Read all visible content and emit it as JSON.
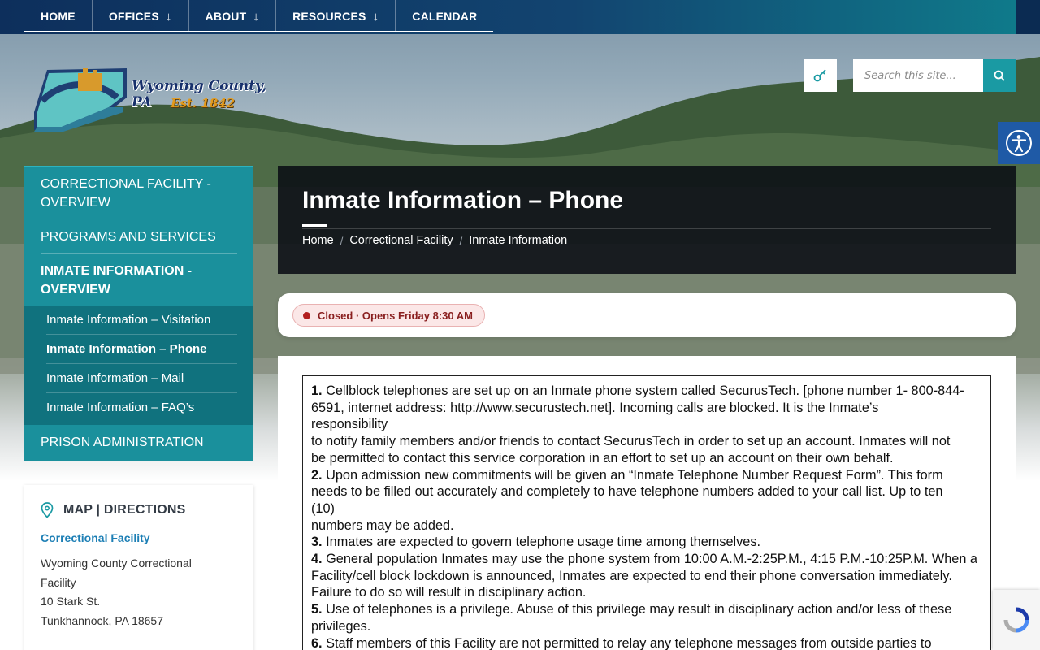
{
  "nav": {
    "items": [
      {
        "label": "HOME",
        "has_dropdown": false
      },
      {
        "label": "OFFICES",
        "has_dropdown": true
      },
      {
        "label": "ABOUT",
        "has_dropdown": true
      },
      {
        "label": "RESOURCES",
        "has_dropdown": true
      },
      {
        "label": "CALENDAR",
        "has_dropdown": false
      }
    ],
    "dropdown_glyph": "↓"
  },
  "logo": {
    "name": "Wyoming County, PA",
    "est": "Est. 1842"
  },
  "search": {
    "placeholder": "Search this site...",
    "button_icon": "search-icon",
    "login_icon": "key-icon"
  },
  "accessibility": {
    "icon": "accessibility-icon"
  },
  "sidebar": {
    "items": [
      {
        "label": "CORRECTIONAL FACILITY - OVERVIEW"
      },
      {
        "label": "PROGRAMS AND SERVICES"
      },
      {
        "label": "INMATE INFORMATION - OVERVIEW"
      }
    ],
    "subitems": [
      {
        "label": "Inmate Information – Visitation"
      },
      {
        "label": "Inmate Information – Phone"
      },
      {
        "label": "Inmate Information – Mail"
      },
      {
        "label": "Inmate Information – FAQ’s"
      }
    ],
    "last_item": {
      "label": "PRISON ADMINISTRATION"
    }
  },
  "map": {
    "title": "MAP | DIRECTIONS",
    "link": "Correctional Facility",
    "address": [
      "Wyoming County Correctional",
      "Facility",
      "10 Stark St.",
      "Tunkhannock, PA 18657"
    ]
  },
  "page": {
    "title": "Inmate Information – Phone",
    "breadcrumbs": [
      "Home",
      "Correctional Facility",
      "Inmate Information"
    ],
    "separator": "/"
  },
  "status": {
    "text": "Closed · Opens Friday 8:30 AM",
    "color": "#b21f1f"
  },
  "content": {
    "lines": [
      {
        "num": "1.",
        "text": " Cellblock telephones are set up on an Inmate phone system called SecurusTech. [phone number 1- 800-844-"
      },
      {
        "num": "",
        "text": "6591, internet address: http://www.securustech.net]. Incoming calls are blocked. It is the Inmate’s"
      },
      {
        "num": "",
        "text": "responsibility"
      },
      {
        "num": "",
        "text": "to notify family members and/or friends to contact SecurusTech in order to set up an account. Inmates will not"
      },
      {
        "num": "",
        "text": "be permitted to contact this service corporation in an effort to set up an account on their own behalf."
      },
      {
        "num": "2.",
        "text": " Upon admission new commitments will be given an “Inmate Telephone Number Request Form”. This form"
      },
      {
        "num": "",
        "text": "needs to be filled out accurately and completely to have telephone numbers added to your call list. Up to ten"
      },
      {
        "num": "",
        "text": "(10)"
      },
      {
        "num": "",
        "text": "numbers may be added."
      },
      {
        "num": "3.",
        "text": " Inmates are expected to govern telephone usage time among themselves."
      },
      {
        "num": "4.",
        "text": " General population Inmates may use the phone system from 10:00 A.M.-2:25P.M., 4:15 P.M.-10:25P.M. When a"
      },
      {
        "num": "",
        "text": "Facility/cell block lockdown is announced, Inmates are expected to end their phone conversation immediately."
      },
      {
        "num": "",
        "text": "Failure to do so will result in disciplinary action."
      },
      {
        "num": "5.",
        "text": " Use of telephones is a privilege. Abuse of this privilege may result in disciplinary action and/or less of these"
      },
      {
        "num": "",
        "text": "privileges."
      },
      {
        "num": "6.",
        "text": " Staff members of this Facility are not permitted to relay any telephone messages from outside parties to"
      }
    ]
  },
  "colors": {
    "nav_start": "#0d2f5c",
    "nav_end": "#0f7d8c",
    "sidebar": "#1a909c",
    "sidebar_sub": "#10727e",
    "accent": "#1a9aa3",
    "link": "#1d7fb5",
    "logo_orange": "#e39a1c",
    "logo_blue": "#17306b"
  }
}
